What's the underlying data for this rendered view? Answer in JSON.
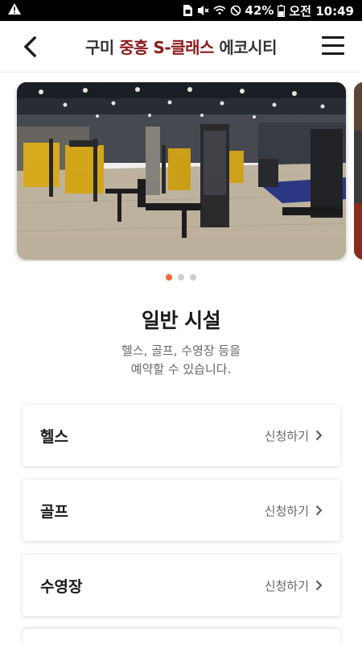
{
  "status_bar": {
    "left_icon": "warning-icon",
    "right_icons": [
      "sim-icon",
      "mute-icon",
      "wifi-icon",
      "do-not-disturb-icon"
    ],
    "battery_percent": "42%",
    "time": "오전 10:49"
  },
  "header": {
    "title_prefix": "구미 ",
    "title_accent": "중흥 S-클래스",
    "title_suffix": " 에코시티",
    "accent_color": "#8b1a1a"
  },
  "carousel": {
    "slide_count": 3,
    "active_index": 0,
    "active_dot_color": "#f0643c"
  },
  "section": {
    "title": "일반 시설",
    "desc_line1": "헬스, 골프, 수영장 등을",
    "desc_line2": "예약할 수 있습니다."
  },
  "facilities": [
    {
      "name": "헬스",
      "action": "신청하기"
    },
    {
      "name": "골프",
      "action": "신청하기"
    },
    {
      "name": "수영장",
      "action": "신청하기"
    }
  ]
}
